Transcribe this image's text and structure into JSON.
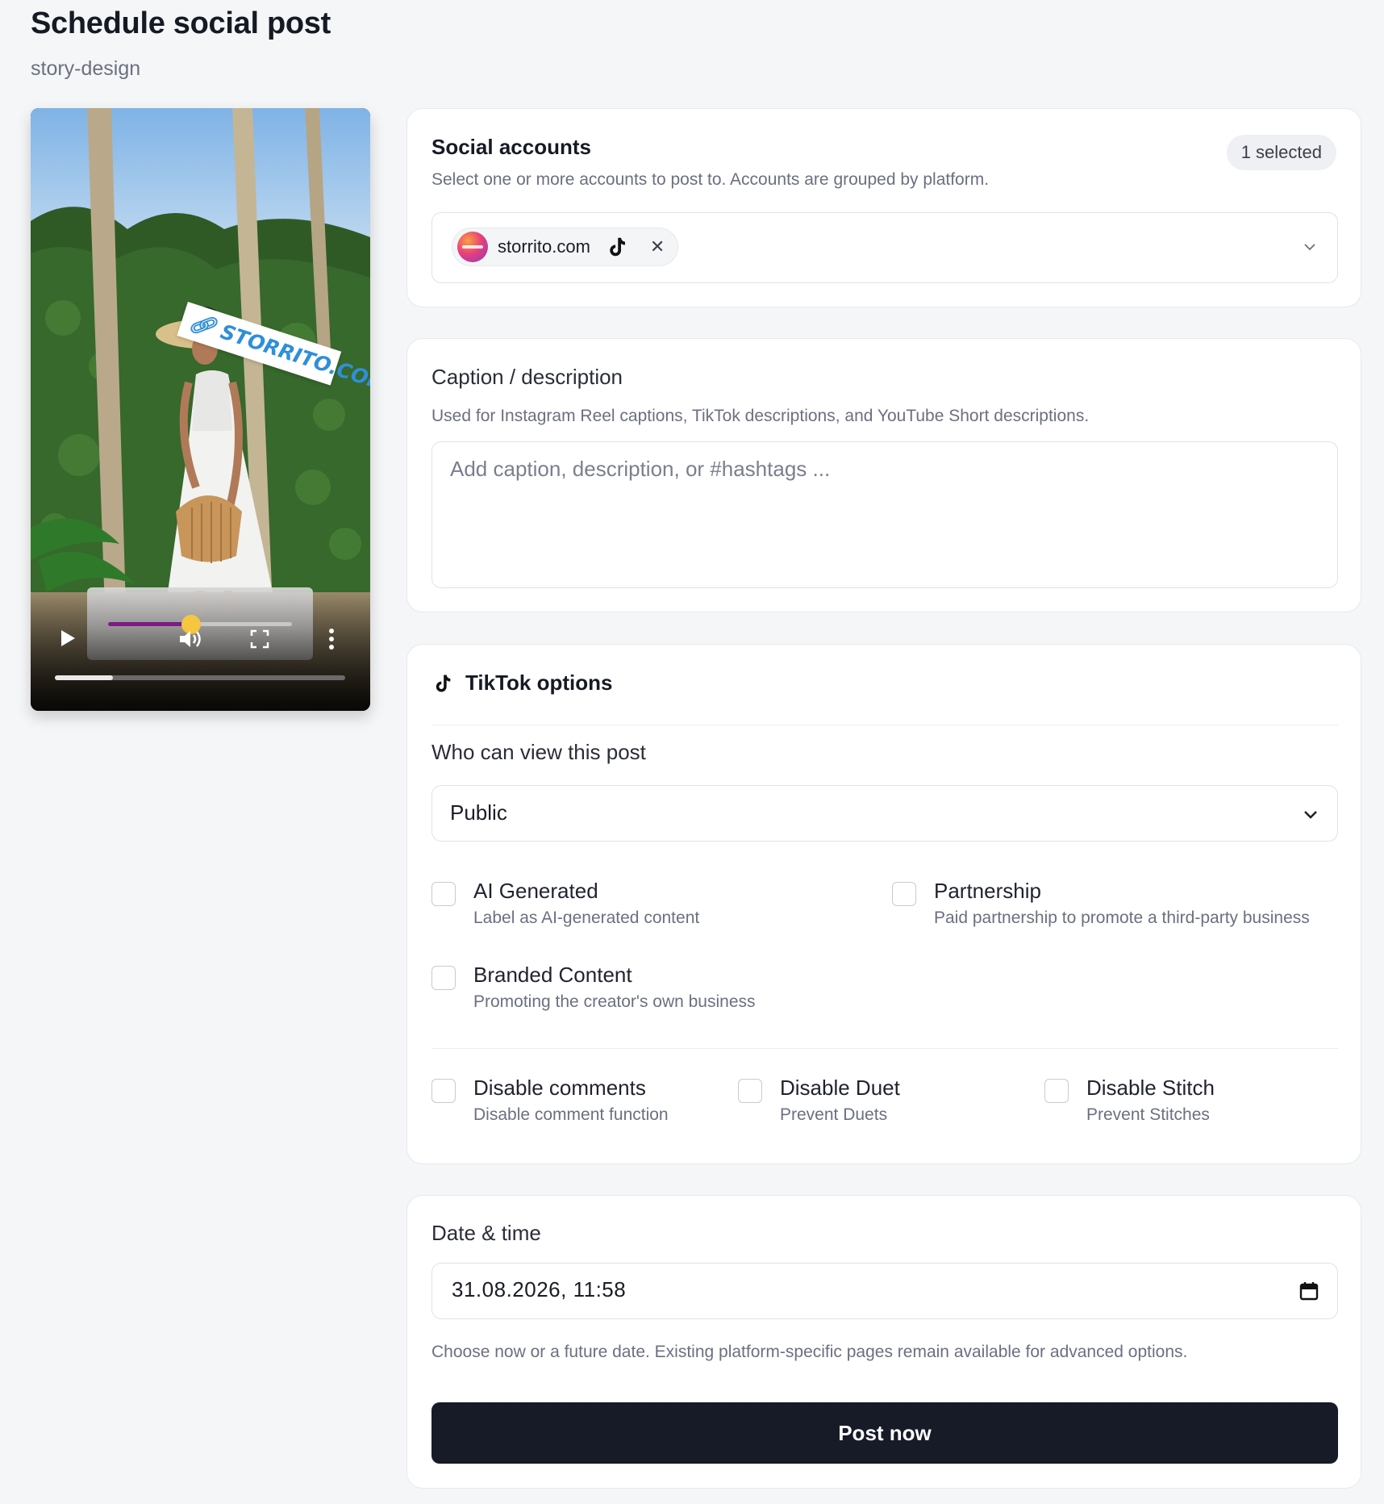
{
  "header": {
    "title": "Schedule social post",
    "subtitle": "story-design"
  },
  "preview": {
    "sticker_text": "STORRITO.COM",
    "controls": [
      "play-icon",
      "volume-icon",
      "fullscreen-icon",
      "more-icon"
    ],
    "volume_level": 0.45,
    "playback_progress": 0.2
  },
  "accounts": {
    "heading": "Social accounts",
    "badge": "1 selected",
    "help": "Select one or more accounts to post to. Accounts are grouped by platform.",
    "selected": [
      {
        "label": "storrito.com",
        "platform_icon": "tiktok-icon"
      }
    ]
  },
  "caption": {
    "label": "Caption / description",
    "help": "Used for Instagram Reel captions, TikTok descriptions, and YouTube Short descriptions.",
    "placeholder": "Add caption, description, or #hashtags ...",
    "value": ""
  },
  "tiktok": {
    "heading": "TikTok options",
    "visibility_label": "Who can view this post",
    "visibility_value": "Public",
    "ai_generated": {
      "title": "AI Generated",
      "desc": "Label as AI-generated content",
      "checked": false
    },
    "partnership": {
      "title": "Partnership",
      "desc": "Paid partnership to promote a third-party business",
      "checked": false
    },
    "branded": {
      "title": "Branded Content",
      "desc": "Promoting the creator's own business",
      "checked": false
    },
    "disable_comments": {
      "title": "Disable comments",
      "desc": "Disable comment function",
      "checked": false
    },
    "disable_duet": {
      "title": "Disable Duet",
      "desc": "Prevent Duets",
      "checked": false
    },
    "disable_stitch": {
      "title": "Disable Stitch",
      "desc": "Prevent Stitches",
      "checked": false
    }
  },
  "schedule": {
    "label": "Date & time",
    "value": "31.08.2026, 11:58",
    "help": "Choose now or a future date. Existing platform-specific pages remain available for advanced options.",
    "submit": "Post now"
  },
  "colors": {
    "primary_button": "#171b28",
    "page_bg": "#f5f6f8",
    "card_bg": "#ffffff",
    "border": "#dfe2e8",
    "muted_text": "#6b7080",
    "sticker_text": "#2f8fd8",
    "volume_fill": "#7b1b86"
  }
}
